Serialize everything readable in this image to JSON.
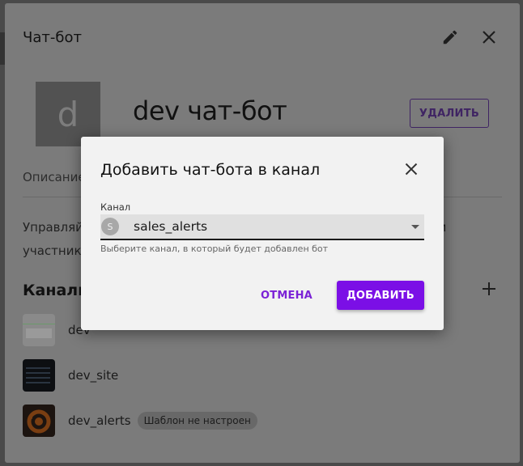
{
  "panel": {
    "title": "Чат-бот",
    "bot_avatar_letter": "d",
    "bot_name": "dev чат-бот",
    "delete_label": "УДАЛИТЬ",
    "tab_description": "Описание",
    "description_line1": "Управляй",
    "description_line2": "участника",
    "description_tail": "м",
    "channels_heading": "Каналы",
    "channels": [
      {
        "name": "dev",
        "badge": ""
      },
      {
        "name": "dev_site",
        "badge": ""
      },
      {
        "name": "dev_alerts",
        "badge": "Шаблон не настроен"
      }
    ],
    "icons": [
      "edit-icon",
      "close-icon",
      "plus-icon"
    ]
  },
  "modal": {
    "title": "Добавить чат-бота в канал",
    "field_label": "Канал",
    "selected_avatar_letter": "S",
    "selected_value": "sales_alerts",
    "helper_text": "Выберите канал, в который будет добавлен бот",
    "cancel_label": "ОТМЕНА",
    "add_label": "ДОБАВИТЬ"
  },
  "colors": {
    "accent": "#7b0fe6",
    "accent_text": "#7b22d6",
    "modal_bg": "#f2f2f2",
    "overlay_panel": "#7b7b7b"
  }
}
